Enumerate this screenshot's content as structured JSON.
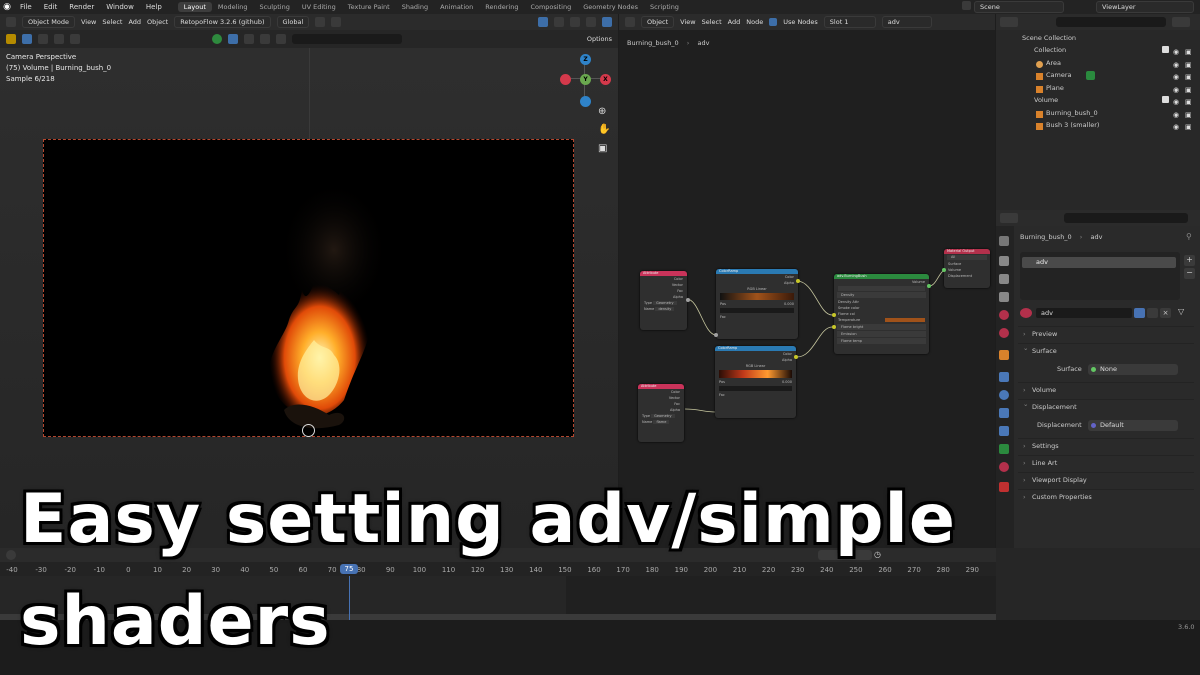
{
  "topbar": {
    "menus": [
      "File",
      "Edit",
      "Render",
      "Window",
      "Help"
    ],
    "workspaces": [
      "Layout",
      "Modeling",
      "Sculpting",
      "UV Editing",
      "Texture Paint",
      "Shading",
      "Animation",
      "Rendering",
      "Compositing",
      "Geometry Nodes",
      "Scripting"
    ],
    "active_workspace": "Layout",
    "scene": "Scene",
    "view_layer": "ViewLayer"
  },
  "viewport": {
    "mode": "Object Mode",
    "menus": [
      "View",
      "Select",
      "Add",
      "Object"
    ],
    "addon": "RetopoFlow 3.2.6 (github)",
    "orientation": "Global",
    "options": "Options",
    "overlay_lines": [
      "Camera Perspective",
      "(75) Volume | Burning_bush_0",
      "Sample 6/218"
    ],
    "gizmo": {
      "x": "X",
      "y": "Y",
      "z": "Z"
    }
  },
  "node_editor": {
    "editor_type": "Object",
    "menus": [
      "View",
      "Select",
      "Add",
      "Node"
    ],
    "use_nodes": "Use Nodes",
    "slot": "Slot 1",
    "material": "adv",
    "breadcrumb": [
      "Burning_bush_0",
      "adv"
    ],
    "nodes": {
      "attr1": {
        "title": "Attribute",
        "outputs": [
          "Color",
          "Vector",
          "Fac",
          "Alpha"
        ],
        "type_label": "Type",
        "type_value": "Geometry",
        "name_label": "Name",
        "name_value": "density"
      },
      "ramp1": {
        "title": "ColorRamp",
        "outputs": [
          "Color",
          "Alpha"
        ],
        "mode": "RGB",
        "interp": "Linear",
        "pos_label": "Pos",
        "pos_value": "0.000",
        "fac": "Fac"
      },
      "attr2": {
        "title": "Attribute",
        "outputs": [
          "Color",
          "Vector",
          "Fac",
          "Alpha"
        ],
        "type_label": "Type",
        "type_value": "Geometry",
        "name_label": "Name",
        "name_value": "flame"
      },
      "ramp2": {
        "title": "ColorRamp",
        "outputs": [
          "Color",
          "Alpha"
        ],
        "mode": "RGB",
        "interp": "Linear",
        "pos_label": "Pos",
        "pos_value": "0.000",
        "fac": "Fac"
      },
      "shader": {
        "title": "adv.BurningBush",
        "output": "Volume",
        "rows": [
          "Density",
          "Density Attr",
          "Smoke color",
          "Flame col",
          "Temperature",
          "Temp color",
          "Flame bright",
          "Emission",
          "Flame temp"
        ]
      },
      "out": {
        "title": "Material Output",
        "target": "All",
        "inputs": [
          "Surface",
          "Volume",
          "Displacement"
        ]
      }
    }
  },
  "outliner": {
    "scene_collection": "Scene Collection",
    "items": [
      {
        "label": "Collection",
        "level": 1
      },
      {
        "label": "Area",
        "level": 2
      },
      {
        "label": "Camera",
        "level": 2
      },
      {
        "label": "Plane",
        "level": 2
      },
      {
        "label": "Volume",
        "level": 1
      },
      {
        "label": "Burning_bush_0",
        "level": 2
      },
      {
        "label": "Bush 3 (smaller)",
        "level": 2
      }
    ]
  },
  "properties": {
    "breadcrumb_obj": "Burning_bush_0",
    "breadcrumb_mat": "adv",
    "slot_name": "adv",
    "material_name": "adv",
    "panels": {
      "preview": "Preview",
      "surface": "Surface",
      "surface_label": "Surface",
      "surface_value": "None",
      "volume": "Volume",
      "displacement": "Displacement",
      "displacement_label": "Displacement",
      "displacement_value": "Default",
      "settings": "Settings",
      "line_art": "Line Art",
      "viewport_display": "Viewport Display",
      "custom_properties": "Custom Properties"
    }
  },
  "timeline": {
    "current_frame": "75",
    "ticks": [
      "-40",
      "-30",
      "-20",
      "-10",
      "0",
      "10",
      "20",
      "30",
      "40",
      "50",
      "60",
      "70",
      "75",
      "80",
      "90",
      "100",
      "110",
      "120",
      "130",
      "140",
      "150",
      "160",
      "170",
      "180",
      "190",
      "200",
      "210",
      "220",
      "230",
      "240",
      "250",
      "260",
      "270",
      "280",
      "290"
    ],
    "version": "3.6.0"
  },
  "caption": {
    "line1": "Easy setting adv/simple",
    "line2": "shaders"
  },
  "colors": {
    "accent_blue": "#4772b3",
    "attr_header": "#c9335a",
    "ramp_header": "#2a7ab3",
    "shader_header": "#2b8a3e",
    "output_header": "#b3304b",
    "fire": "#ff8c1a"
  }
}
